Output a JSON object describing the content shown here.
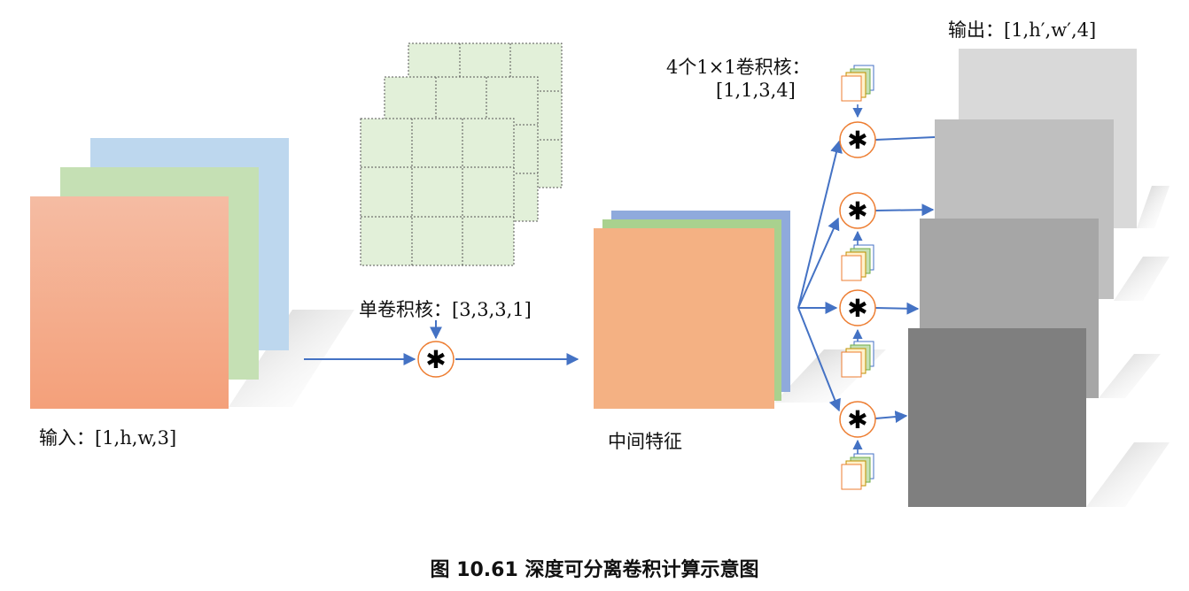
{
  "input_label": {
    "prefix": "输入：",
    "value": "[1,h,w,3]"
  },
  "kernel_label": "单卷积核：[3,3,3,1]",
  "middle_label": "中间特征",
  "pointwise_label": {
    "line1": "4个1×1卷积核：",
    "line2": "[1,1,3,4]"
  },
  "output_label": "输出：[1,h′,w′,4]",
  "operator_symbol": "✱",
  "caption": "图  10.61  深度可分离卷积计算示意图",
  "colors": {
    "red_channel": "#f3a47e",
    "green_channel": "#c5e0b4",
    "blue_channel": "#bdd7ee",
    "kernel_fill": "#e2f0d9",
    "arrow": "#4472c4",
    "operator_ring": "#ed7d31",
    "mid_orange": "#f4b183",
    "mid_green": "#a9d18e",
    "mid_blue": "#8faadc"
  }
}
